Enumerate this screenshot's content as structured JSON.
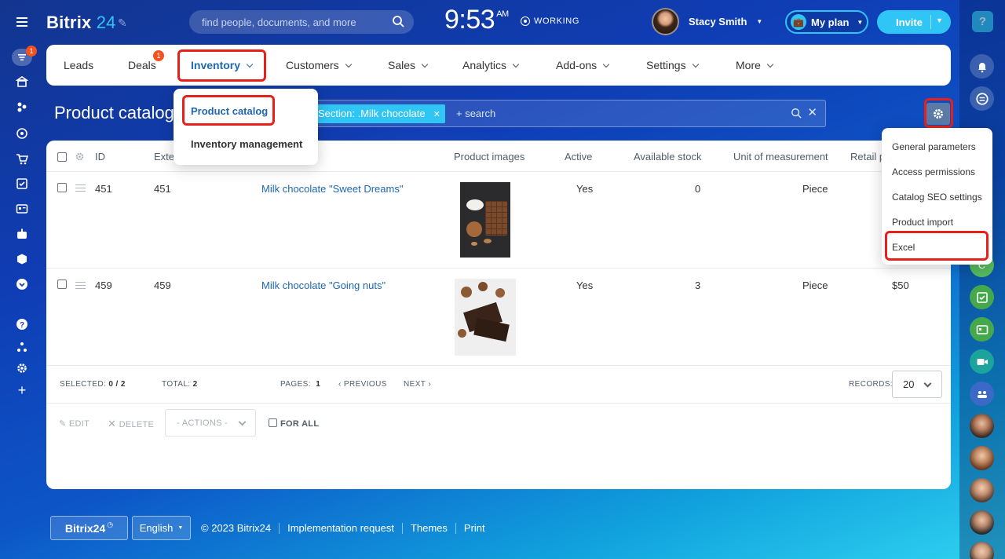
{
  "app": {
    "logo_text": "Bitrix",
    "logo_num": "24"
  },
  "search": {
    "placeholder": "find people, documents, and more"
  },
  "clock": {
    "time": "9:53",
    "ampm": "AM",
    "status": "WORKING"
  },
  "user": {
    "name": "Stacy Smith"
  },
  "plan_label": "My plan",
  "invite_label": "Invite",
  "help_label": "?",
  "leftbar": {
    "notif_count": "1"
  },
  "menu": {
    "items": [
      {
        "label": "Leads"
      },
      {
        "label": "Deals",
        "badge": "1"
      },
      {
        "label": "Inventory"
      },
      {
        "label": "Customers"
      },
      {
        "label": "Sales"
      },
      {
        "label": "Analytics"
      },
      {
        "label": "Add-ons"
      },
      {
        "label": "Settings"
      },
      {
        "label": "More"
      }
    ]
  },
  "inventory_dropdown": {
    "items": [
      "Product catalog",
      "Inventory management"
    ]
  },
  "page": {
    "title": "Product catalog"
  },
  "filter": {
    "chip": "Section: .Milk chocolate",
    "search_placeholder": "+ search"
  },
  "settings_menu": {
    "items": [
      "General parameters",
      "Access permissions",
      "Catalog SEO settings",
      "Product import",
      "Excel"
    ]
  },
  "table": {
    "columns": {
      "id": "ID",
      "ext": "Exte",
      "images": "Product images",
      "active": "Active",
      "stock": "Available stock",
      "unit": "Unit of measurement",
      "retail": "Retail p"
    },
    "rows": [
      {
        "id": "451",
        "ext": "451",
        "name": "Milk chocolate \"Sweet Dreams\"",
        "active": "Yes",
        "stock": "0",
        "unit": "Piece",
        "price": ""
      },
      {
        "id": "459",
        "ext": "459",
        "name": "Milk chocolate \"Going nuts\"",
        "active": "Yes",
        "stock": "3",
        "unit": "Piece",
        "price": "$50"
      }
    ]
  },
  "footer_bar": {
    "selected_label": "SELECTED:",
    "selected_val": "0 / 2",
    "total_label": "TOTAL:",
    "total_val": "2",
    "pages_label": "PAGES:",
    "pages_val": "1",
    "prev": "PREVIOUS",
    "next": "NEXT",
    "records_label": "RECORDS:",
    "records_val": "20"
  },
  "actions": {
    "edit": "EDIT",
    "delete": "DELETE",
    "select": "- ACTIONS -",
    "for_all": "FOR ALL"
  },
  "page_footer": {
    "logo": "Bitrix24",
    "lang": "English",
    "copyright": "© 2023 Bitrix24",
    "links": [
      "Implementation request",
      "Themes",
      "Print"
    ]
  },
  "colors": {
    "accent": "#2fc6f6",
    "highlight": "#e8201c",
    "link": "#2067b0",
    "bg": "#0f3db5"
  }
}
